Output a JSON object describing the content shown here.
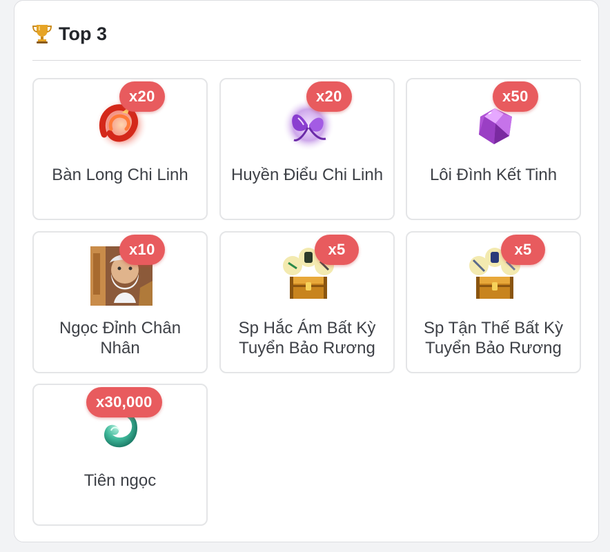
{
  "header": {
    "title": "Top 3",
    "icon": "trophy-icon"
  },
  "items": [
    {
      "name": "Bàn Long Chi Linh",
      "qty": "x20",
      "icon": "red-dragon-spirit-icon"
    },
    {
      "name": "Huyền Điểu Chi Linh",
      "qty": "x20",
      "icon": "purple-butterfly-spirit-icon"
    },
    {
      "name": "Lôi Đình Kết Tinh",
      "qty": "x50",
      "icon": "purple-crystal-icon"
    },
    {
      "name": "Ngọc Đỉnh Chân Nhân",
      "qty": "x10",
      "icon": "old-sage-portrait-icon"
    },
    {
      "name": "Sp Hắc Ám Bất Kỳ Tuyển Bảo Rương",
      "qty": "x5",
      "icon": "treasure-chest-dark-icon"
    },
    {
      "name": "Sp Tận Thế Bất Kỳ Tuyển Bảo Rương",
      "qty": "x5",
      "icon": "treasure-chest-doom-icon"
    },
    {
      "name": "Tiên ngọc",
      "qty": "x30,000",
      "icon": "jade-gem-icon"
    }
  ]
}
